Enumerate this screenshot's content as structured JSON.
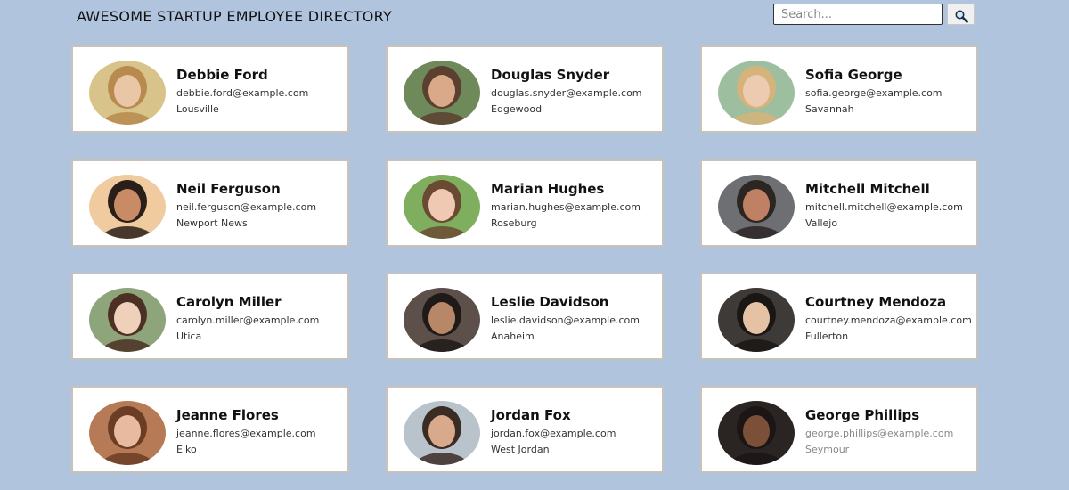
{
  "header": {
    "title": "AWESOME STARTUP EMPLOYEE DIRECTORY",
    "search_placeholder": "Search...",
    "search_icon": "magnifier-icon"
  },
  "employees": [
    {
      "name": "Debbie Ford",
      "email": "debbie.ford@example.com",
      "city": "Lousville",
      "photo_bg": "#d8c48a",
      "hair": "#b98a4e",
      "skin": "#e9c6a6"
    },
    {
      "name": "Douglas Snyder",
      "email": "douglas.snyder@example.com",
      "city": "Edgewood",
      "photo_bg": "#6f8a5a",
      "hair": "#5b4030",
      "skin": "#d9a98a"
    },
    {
      "name": "Sofia George",
      "email": "sofia.george@example.com",
      "city": "Savannah",
      "photo_bg": "#9dbfa0",
      "hair": "#d6b37a",
      "skin": "#eccbb0"
    },
    {
      "name": "Neil Ferguson",
      "email": "neil.ferguson@example.com",
      "city": "Newport News",
      "photo_bg": "#f1cba0",
      "hair": "#2a1f18",
      "skin": "#c98b66"
    },
    {
      "name": "Marian Hughes",
      "email": "marian.hughes@example.com",
      "city": "Roseburg",
      "photo_bg": "#7fae5f",
      "hair": "#6b4a33",
      "skin": "#efc9b1"
    },
    {
      "name": "Mitchell Mitchell",
      "email": "mitchell.mitchell@example.com",
      "city": "Vallejo",
      "photo_bg": "#6d6f72",
      "hair": "#2c2623",
      "skin": "#c08064"
    },
    {
      "name": "Carolyn Miller",
      "email": "carolyn.miller@example.com",
      "city": "Utica",
      "photo_bg": "#8ea47b",
      "hair": "#4b3023",
      "skin": "#efd0bb"
    },
    {
      "name": "Leslie Davidson",
      "email": "leslie.davidson@example.com",
      "city": "Anaheim",
      "photo_bg": "#5d4f49",
      "hair": "#1f1a18",
      "skin": "#b88768"
    },
    {
      "name": "Courtney Mendoza",
      "email": "courtney.mendoza@example.com",
      "city": "Fullerton",
      "photo_bg": "#3d3a38",
      "hair": "#1a1614",
      "skin": "#e5c2a4"
    },
    {
      "name": "Jeanne Flores",
      "email": "jeanne.flores@example.com",
      "city": "Elko",
      "photo_bg": "#b77a56",
      "hair": "#6a3d24",
      "skin": "#e8bba0"
    },
    {
      "name": "Jordan Fox",
      "email": "jordan.fox@example.com",
      "city": "West Jordan",
      "photo_bg": "#b9c3cc",
      "hair": "#3a2c23",
      "skin": "#d9a98c"
    },
    {
      "name": "George Phillips",
      "email": "george.phillips@example.com",
      "city": "Seymour",
      "photo_bg": "#2a2523",
      "hair": "#1b1615",
      "skin": "#7c4f38"
    }
  ]
}
